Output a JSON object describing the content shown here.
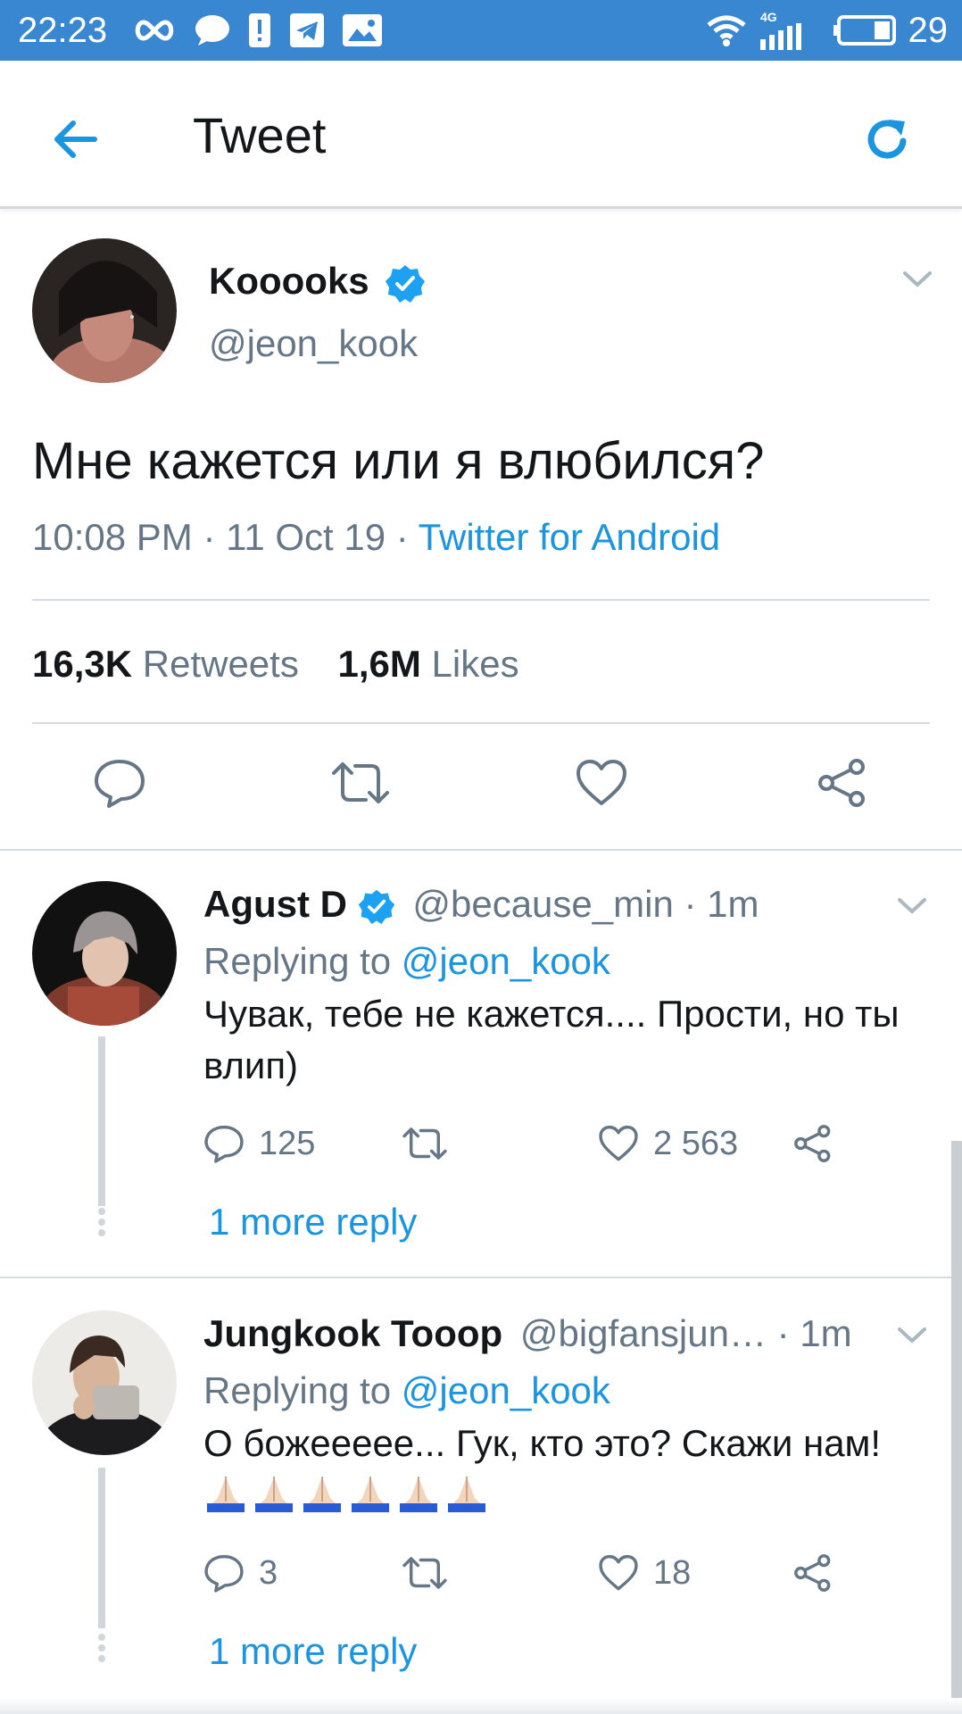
{
  "status_bar": {
    "time": "22:23",
    "network": "4G",
    "battery": "29",
    "icons": [
      "infinity-icon",
      "chat-bubble-icon",
      "alert-icon",
      "telegram-icon",
      "image-icon",
      "wifi-icon",
      "signal-icon",
      "battery-icon"
    ]
  },
  "header": {
    "title": "Tweet",
    "back_icon": "arrow-left-icon",
    "refresh_icon": "refresh-icon"
  },
  "colors": {
    "status_bar": "#3a87d1",
    "link": "#1b95e0",
    "muted": "#657786",
    "text": "#14171a"
  },
  "main_tweet": {
    "name": "Kooooks",
    "handle": "@jeon_kook",
    "text": "Мне кажется или я влюбился?",
    "time": "10:08 PM · 11 Oct 19 · ",
    "source": "Twitter for Android",
    "retweets_count": "16,3K",
    "retweets_label": "Retweets",
    "likes_count": "1,6M",
    "likes_label": "Likes"
  },
  "replies": [
    {
      "name": "Agust D",
      "handle": "@because_min · 1m",
      "replying_label": "Replying to ",
      "replying_to": "@jeon_kook",
      "text": "Чувак, тебе не кажется.... Прости, но ты влип)",
      "reply_count": "125",
      "retweet_count": "",
      "like_count": "2 563",
      "more": "1 more reply"
    },
    {
      "name": "Jungkook Tooop",
      "handle": "@bigfansjun… · 1m",
      "replying_label": "Replying to ",
      "replying_to": "@jeon_kook",
      "text": "О божеееее... Гук, кто это? Скажи нам!",
      "emoji": "🙏🏻🙏🏻🙏🏻🙏🏻🙏🏻🙏🏻",
      "reply_count": "3",
      "retweet_count": "",
      "like_count": "18",
      "more": "1 more reply"
    }
  ]
}
